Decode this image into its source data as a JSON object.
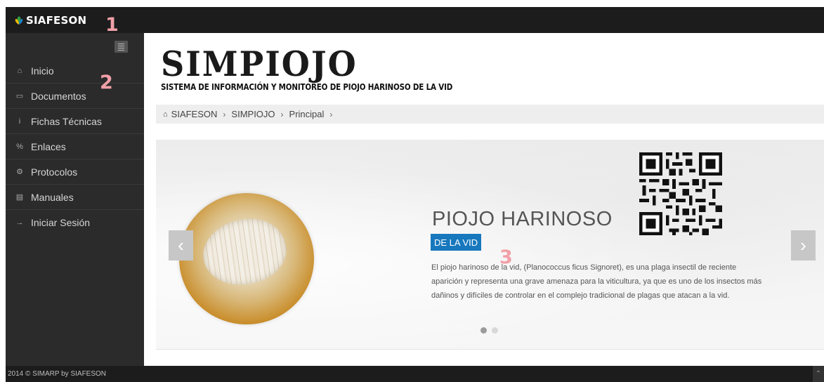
{
  "header": {
    "brand": "SIAFESON"
  },
  "sidebar": {
    "items": [
      {
        "label": "Inicio",
        "icon": "home-icon",
        "glyph": "⌂"
      },
      {
        "label": "Documentos",
        "icon": "folder-icon",
        "glyph": "▭"
      },
      {
        "label": "Fichas Técnicas",
        "icon": "info-icon",
        "glyph": "i"
      },
      {
        "label": "Enlaces",
        "icon": "link-icon",
        "glyph": "%"
      },
      {
        "label": "Protocolos",
        "icon": "gear-icon",
        "glyph": "⚙"
      },
      {
        "label": "Manuales",
        "icon": "book-icon",
        "glyph": "▤"
      },
      {
        "label": "Iniciar Sesión",
        "icon": "sign-in-icon",
        "glyph": "→"
      }
    ]
  },
  "main": {
    "title": "SIMPIOJO",
    "subtitle": "SISTEMA DE INFORMACIÓN Y MONITOREO DE PIOJO HARINOSO DE LA VID",
    "breadcrumb": [
      "SIAFESON",
      "SIMPIOJO",
      "Principal"
    ],
    "slide": {
      "title": "PIOJO HARINOSO",
      "badge": "DE LA VID",
      "text": "El piojo harinoso de la vid, (Planococcus ficus Signoret), es una plaga insectil de reciente aparición y representa una grave amenaza para la viticultura, ya que es uno de los insectos más dañinos y difíciles de controlar en el complejo tradicional de plagas que atacan a la vid.",
      "prev": "‹",
      "next": "›"
    }
  },
  "markers": [
    "1",
    "2",
    "3"
  ],
  "footer": {
    "text": "2014 © SIMARP by SIAFESON",
    "scroll_top": "⌃"
  },
  "colors": {
    "topbar": "#1c1c1c",
    "sidebar": "#2b2b2b",
    "badge": "#1778bd"
  }
}
